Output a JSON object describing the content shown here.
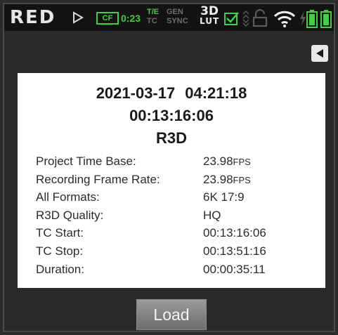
{
  "statusbar": {
    "brand": "RED",
    "media_badge": "CF",
    "media_time": "0:23",
    "te_label": "T/E",
    "tc_label": "TC",
    "gen_label": "GEN",
    "sync_label": "SYNC",
    "lut_top": "3D",
    "lut_bottom": "LUT",
    "icons": [
      "play-arrow-icon",
      "checkbox-icon",
      "arrows-icon",
      "lock-icon",
      "wifi-icon",
      "bolt-icon",
      "battery-icon"
    ],
    "colors": {
      "accent_green": "#3fd13f",
      "inactive_gray": "#6e6e6e"
    }
  },
  "clip": {
    "date": "2021-03-17",
    "time": "04:21:18",
    "timecode": "00:13:16:06",
    "format": "R3D"
  },
  "details": [
    {
      "label": "Project Time Base:",
      "value": "23.98",
      "unit": "FPS"
    },
    {
      "label": "Recording Frame Rate:",
      "value": "23.98",
      "unit": "FPS"
    },
    {
      "label": "All Formats:",
      "value": "6K 17:9",
      "unit": ""
    },
    {
      "label": "R3D Quality:",
      "value": "HQ",
      "unit": ""
    },
    {
      "label": "TC Start:",
      "value": "00:13:16:06",
      "unit": ""
    },
    {
      "label": "TC Stop:",
      "value": "00:13:51:16",
      "unit": ""
    },
    {
      "label": "Duration:",
      "value": "00:00:35:11",
      "unit": ""
    }
  ],
  "actions": {
    "load_label": "Load"
  }
}
